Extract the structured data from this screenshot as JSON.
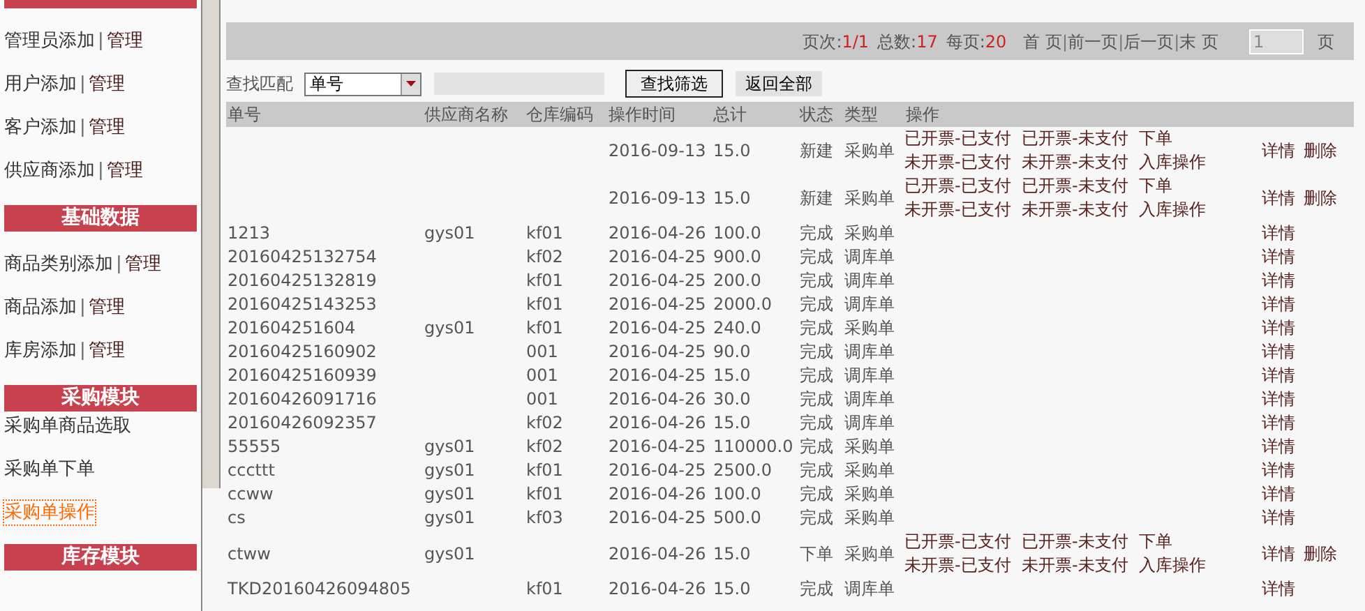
{
  "sidebar": {
    "groups": [
      {
        "items": [
          {
            "label": "管理员添加",
            "separator": "|",
            "manage": "管理",
            "selected": false
          },
          {
            "label": "用户添加",
            "separator": "|",
            "manage": "管理",
            "selected": false
          },
          {
            "label": "客户添加",
            "separator": "|",
            "manage": "管理",
            "selected": false
          },
          {
            "label": "供应商添加",
            "separator": "|",
            "manage": "管理",
            "selected": false
          }
        ]
      },
      {
        "title": "基础数据",
        "items": [
          {
            "label": "商品类别添加",
            "separator": "|",
            "manage": "管理",
            "selected": false
          },
          {
            "label": "商品添加",
            "separator": "|",
            "manage": "管理",
            "selected": false
          },
          {
            "label": "库房添加",
            "separator": "|",
            "manage": "管理",
            "selected": false
          }
        ]
      },
      {
        "title": "采购模块",
        "items": [
          {
            "label": "采购单商品选取",
            "selected": false
          },
          {
            "label": "采购单下单",
            "selected": false
          },
          {
            "label": "采购单操作",
            "selected": true
          }
        ]
      },
      {
        "title": "库存模块"
      }
    ]
  },
  "pager": {
    "page_label": "页次:",
    "page": "1/1",
    "total_label": "总数:",
    "total": "17",
    "per_page_label": "每页:",
    "per_page": "20",
    "links": [
      "首 页",
      "前一页",
      "后一页",
      "末 页"
    ],
    "separator": "|",
    "page_input": "1",
    "unit": "页"
  },
  "search": {
    "label": "查找匹配",
    "select": "单号",
    "search_button": "查找筛选",
    "reset_button": "返回全部"
  },
  "table": {
    "columns": [
      "单号",
      "供应商名称",
      "仓库编码",
      "操作时间",
      "总计",
      "状态",
      "类型",
      "操作"
    ],
    "rows": [
      {
        "kind": "ops",
        "cells": [
          "",
          "",
          "",
          "2016-09-13",
          "15.0",
          "新建",
          "采购单"
        ],
        "operations": [
          "已开票-已支付",
          "已开票-未支付",
          "下单",
          "未开票-已支付",
          "未开票-未支付",
          "入库操作"
        ],
        "actions": [
          "详情",
          "删除"
        ]
      },
      {
        "kind": "ops",
        "cells": [
          "",
          "",
          "",
          "2016-09-13",
          "15.0",
          "新建",
          "采购单"
        ],
        "operations": [
          "已开票-已支付",
          "已开票-未支付",
          "下单",
          "未开票-已支付",
          "未开票-未支付",
          "入库操作"
        ],
        "actions": [
          "详情",
          "删除"
        ]
      },
      {
        "kind": "plain",
        "cells": [
          "1213",
          "gys01",
          "kf01",
          "2016-04-26",
          "100.0",
          "完成",
          "采购单"
        ],
        "actions": [
          "详情"
        ]
      },
      {
        "kind": "plain",
        "cells": [
          "20160425132754",
          "",
          "kf02",
          "2016-04-25",
          "900.0",
          "完成",
          "调库单"
        ],
        "actions": [
          "详情"
        ]
      },
      {
        "kind": "plain",
        "cells": [
          "20160425132819",
          "",
          "kf01",
          "2016-04-25",
          "200.0",
          "完成",
          "调库单"
        ],
        "actions": [
          "详情"
        ]
      },
      {
        "kind": "plain",
        "cells": [
          "20160425143253",
          "",
          "kf01",
          "2016-04-25",
          "2000.0",
          "完成",
          "调库单"
        ],
        "actions": [
          "详情"
        ]
      },
      {
        "kind": "plain",
        "cells": [
          "201604251604",
          "gys01",
          "kf01",
          "2016-04-25",
          "240.0",
          "完成",
          "采购单"
        ],
        "actions": [
          "详情"
        ]
      },
      {
        "kind": "plain",
        "cells": [
          "20160425160902",
          "",
          "001",
          "2016-04-25",
          "90.0",
          "完成",
          "调库单"
        ],
        "actions": [
          "详情"
        ]
      },
      {
        "kind": "plain",
        "cells": [
          "20160425160939",
          "",
          "001",
          "2016-04-25",
          "15.0",
          "完成",
          "调库单"
        ],
        "actions": [
          "详情"
        ]
      },
      {
        "kind": "plain",
        "cells": [
          "20160426091716",
          "",
          "001",
          "2016-04-26",
          "30.0",
          "完成",
          "调库单"
        ],
        "actions": [
          "详情"
        ]
      },
      {
        "kind": "plain",
        "cells": [
          "20160426092357",
          "",
          "kf02",
          "2016-04-26",
          "15.0",
          "完成",
          "调库单"
        ],
        "actions": [
          "详情"
        ]
      },
      {
        "kind": "plain",
        "cells": [
          "55555",
          "gys01",
          "kf02",
          "2016-04-25",
          "110000.0",
          "完成",
          "采购单"
        ],
        "actions": [
          "详情"
        ]
      },
      {
        "kind": "plain",
        "cells": [
          "cccttt",
          "gys01",
          "kf01",
          "2016-04-25",
          "2500.0",
          "完成",
          "采购单"
        ],
        "actions": [
          "详情"
        ]
      },
      {
        "kind": "plain",
        "cells": [
          "ccww",
          "gys01",
          "kf01",
          "2016-04-26",
          "100.0",
          "完成",
          "采购单"
        ],
        "actions": [
          "详情"
        ]
      },
      {
        "kind": "plain",
        "cells": [
          "cs",
          "gys01",
          "kf03",
          "2016-04-25",
          "500.0",
          "完成",
          "采购单"
        ],
        "actions": [
          "详情"
        ]
      },
      {
        "kind": "ops",
        "cells": [
          "ctww",
          "gys01",
          "",
          "2016-04-26",
          "15.0",
          "下单",
          "采购单"
        ],
        "operations": [
          "已开票-已支付",
          "已开票-未支付",
          "下单",
          "未开票-已支付",
          "未开票-未支付",
          "入库操作"
        ],
        "actions": [
          "详情",
          "删除"
        ]
      },
      {
        "kind": "plain",
        "cells": [
          "TKD20160426094805",
          "",
          "kf01",
          "2016-04-26",
          "15.0",
          "完成",
          "调库单"
        ],
        "actions": [
          "详情"
        ]
      }
    ]
  }
}
